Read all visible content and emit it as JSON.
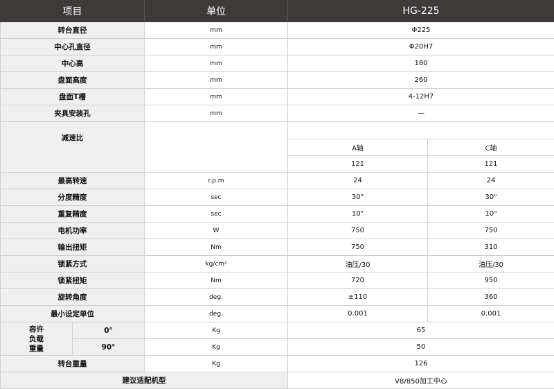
{
  "header": {
    "item": "项目",
    "unit": "单位",
    "model": "HG-225"
  },
  "rows": [
    {
      "label": "转台直径",
      "unit": "mm",
      "value": "Φ225"
    },
    {
      "label": "中心孔直径",
      "unit": "mm",
      "value": "Φ20H7"
    },
    {
      "label": "中心高",
      "unit": "mm",
      "value": "180"
    },
    {
      "label": "盘面高度",
      "unit": "mm",
      "value": "260"
    },
    {
      "label": "盘面T槽",
      "unit": "mm",
      "value": "4-12H7"
    },
    {
      "label": "夹具安装孔",
      "unit": "mm",
      "value": "—"
    }
  ],
  "reduction": {
    "label": "减速比",
    "axis_a": "A轴",
    "axis_c": "C轴",
    "a": "121",
    "c": "121"
  },
  "split_rows": [
    {
      "label": "最高转速",
      "unit": "r.p.m",
      "a": "24",
      "c": "24"
    },
    {
      "label": "分度精度",
      "unit": "sec",
      "a": "30\"",
      "c": "30\""
    },
    {
      "label": "重复精度",
      "unit": "sec",
      "a": "10\"",
      "c": "10\""
    },
    {
      "label": "电机功率",
      "unit": "W",
      "a": "750",
      "c": "750"
    },
    {
      "label": "输出扭矩",
      "unit": "Nm",
      "a": "750",
      "c": "310"
    },
    {
      "label": "锁紧方式",
      "unit": "kg/cm²",
      "a": "油压/30",
      "c": "油压/30"
    },
    {
      "label": "锁紧扭矩",
      "unit": "Nm",
      "a": "720",
      "c": "950"
    },
    {
      "label": "旋转角度",
      "unit": "deg.",
      "a": "±110",
      "c": "360"
    },
    {
      "label": "最小设定单位",
      "unit": "deg.",
      "a": "0.001",
      "c": "0.001"
    }
  ],
  "load": {
    "label_lines": [
      "容许",
      "负载",
      "重量"
    ],
    "rows": [
      {
        "angle": "0°",
        "unit": "Kg",
        "value": "65"
      },
      {
        "angle": "90°",
        "unit": "Kg",
        "value": "50"
      }
    ]
  },
  "weight": {
    "label": "转台重量",
    "unit": "Kg",
    "value": "126"
  },
  "machine": {
    "label": "建议适配机型",
    "value": "V8/850加工中心"
  }
}
